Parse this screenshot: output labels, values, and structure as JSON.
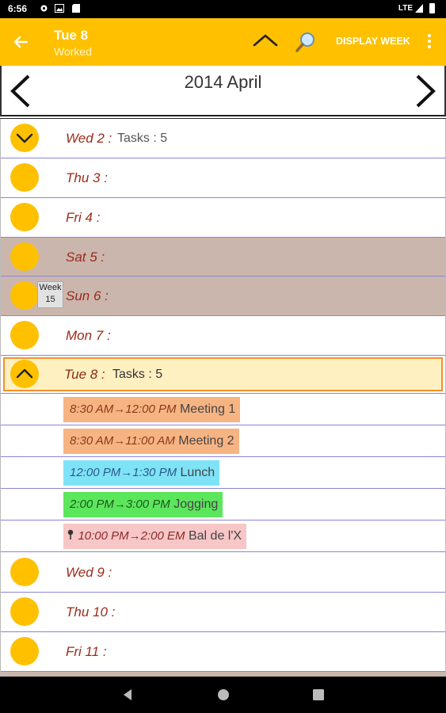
{
  "status_bar": {
    "time": "6:56",
    "network": "LTE",
    "icons": [
      "settings-icon",
      "image-icon",
      "sd-card-icon",
      "signal-icon",
      "battery-icon"
    ]
  },
  "toolbar": {
    "title": "Tue 8",
    "subtitle": "Worked",
    "display_week_label": "DISPLAY WEEK",
    "background": "#ffc000"
  },
  "month_header": {
    "title": "2014 April"
  },
  "days": [
    {
      "label": "Wed 2 :",
      "tasks": "Tasks : 5",
      "expand": "chevron-down"
    },
    {
      "label": "Thu 3 :",
      "tasks": ""
    },
    {
      "label": "Fri 4 :",
      "tasks": ""
    },
    {
      "label": "Sat 5 :",
      "tasks": "",
      "weekend": true
    },
    {
      "label": "Sun 6 :",
      "tasks": "",
      "weekend": true,
      "week_badge": {
        "line1": "Week",
        "line2": "15"
      }
    },
    {
      "label": "Mon 7 :",
      "tasks": ""
    },
    {
      "label": "Tue 8 :",
      "tasks": "Tasks : 5",
      "selected": true,
      "expand": "chevron-up"
    },
    {
      "label": "Wed 9 :",
      "tasks": ""
    },
    {
      "label": "Thu 10 :",
      "tasks": ""
    },
    {
      "label": "Fri 11 :",
      "tasks": ""
    }
  ],
  "tasks": [
    {
      "time": "8:30 AM→12:00 PM",
      "name": "Meeting 1",
      "color": "#f7b483",
      "time_color": "#8a3a1a"
    },
    {
      "time": "8:30 AM→11:00 AM",
      "name": "Meeting 2",
      "color": "#f7b483",
      "time_color": "#8a3a1a"
    },
    {
      "time": "12:00 PM→1:30 PM",
      "name": "Lunch",
      "color": "#7fe3f7",
      "time_color": "#2a5a8a"
    },
    {
      "time": "2:00 PM→3:00 PM",
      "name": "Jogging",
      "color": "#5ce65c",
      "time_color": "#1a5a1a"
    },
    {
      "time": "10:00 PM→2:00 EM",
      "name": "Bal de l'X",
      "color": "#f7c6c6",
      "time_color": "#8a2a2a",
      "pin": true
    }
  ],
  "colors": {
    "accent": "#ffc000",
    "weekend": "#cbb6ad",
    "selected_bg": "#fff0c2",
    "selected_border": "#f29030",
    "separator": "#8a84d8",
    "day_text": "#9b2b1a"
  }
}
